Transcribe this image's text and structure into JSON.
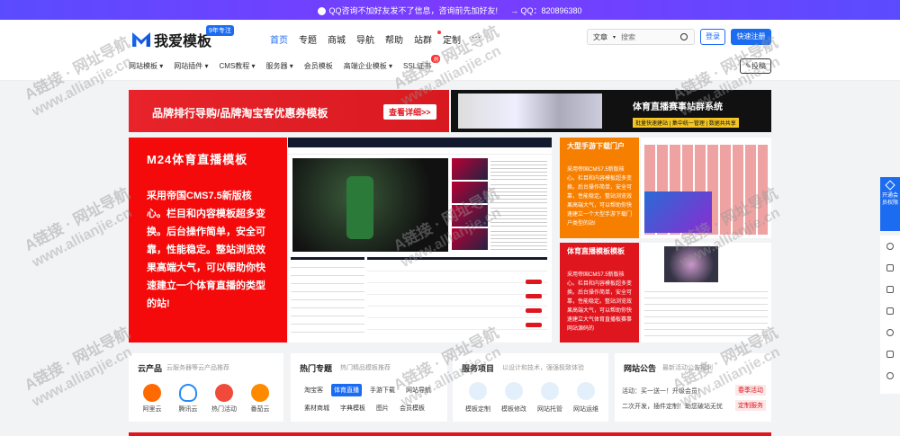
{
  "topbar": {
    "notice": "QQ咨询不加好友发不了信息，咨询前先加好友!",
    "qq_label": "QQ：",
    "qq": "820896380"
  },
  "header": {
    "logo_text": "我爱模板",
    "logo_badge": "9年专注",
    "nav": [
      {
        "label": "首页"
      },
      {
        "label": "专题"
      },
      {
        "label": "商城"
      },
      {
        "label": "导航"
      },
      {
        "label": "帮助"
      },
      {
        "label": "站群"
      },
      {
        "label": "定制"
      },
      {
        "label": "···"
      }
    ],
    "search_select": "文章",
    "search_placeholder": "搜索",
    "login": "登录",
    "register": "快速注册",
    "subnav": [
      {
        "label": "网站模板"
      },
      {
        "label": "网站插件"
      },
      {
        "label": "CMS教程"
      },
      {
        "label": "服务器"
      },
      {
        "label": "会员模板"
      },
      {
        "label": "高端企业模板"
      },
      {
        "label": "SSL证书"
      }
    ],
    "subnav_hot": "热",
    "post_button": "投稿"
  },
  "banners": {
    "left_title": "品牌排行导购/品牌淘宝客优惠券模板",
    "left_button": "查看详细>>",
    "right_title": "体育直播赛事站群系统",
    "right_sub": "批量快速建站 | 集中统一管理 | 数据共共享"
  },
  "promo": {
    "title": "M24体育直播模板",
    "desc": "采用帝国CMS7.5新版核心。栏目和内容模板超多变换。后台操作简单，安全可靠，性能稳定。整站浏览效果高端大气，可以帮助你快速建立一个体育直播的类型的站!"
  },
  "side_promos": {
    "p1_title": "大型手游下载门户",
    "p1_desc": "采用帝国CMS7.5新版核心。栏目和内容模板超多变换。后台操作简单，安全可靠，性能稳定。整站浏览效果高端大气，可以帮助你快速建立一个大型手游下载门户类型的站!",
    "p2_title": "体育直播模板模板",
    "p2_desc": "采用帝国CMS7.5新版核心。栏目和内容模板超多变换。后台操作简单，安全可靠，性能稳定。整站浏览效果高端大气，可以帮助你快速建立大气体育直播板赛事网站源码的"
  },
  "cards": {
    "cloud": {
      "title": "云产品",
      "sub": "云服务器等云产品推荐",
      "items": [
        {
          "label": "阿里云"
        },
        {
          "label": "腾讯云"
        },
        {
          "label": "热门活动"
        },
        {
          "label": "番茄云"
        }
      ]
    },
    "topics": {
      "title": "热门专题",
      "sub": "热门精品模板推荐",
      "tags": [
        {
          "label": "淘宝客"
        },
        {
          "label": "体育直播"
        },
        {
          "label": "手游下载"
        },
        {
          "label": "网站导航"
        },
        {
          "label": "素材商城"
        },
        {
          "label": "字典模板"
        },
        {
          "label": "图片"
        },
        {
          "label": "会员模板"
        }
      ]
    },
    "services": {
      "title": "服务项目",
      "sub": "以设计和技术，强强极致体验",
      "items": [
        {
          "label": "模板定制"
        },
        {
          "label": "模板修改"
        },
        {
          "label": "网站托管"
        },
        {
          "label": "网站运维"
        }
      ]
    },
    "notice": {
      "title": "网站公告",
      "sub": "最新活动公告福利",
      "lines": [
        {
          "text": "活动：买一送一！升级会员！",
          "pill": "春季活动"
        },
        {
          "text": "二次开发，插件定制！助您破站无忧",
          "pill": "定制服务"
        }
      ]
    }
  },
  "sidebar": {
    "vip": "开通会员权限"
  },
  "watermark": {
    "cn": "A链接 · 网址导航",
    "url": "www.allianjie.cn"
  }
}
